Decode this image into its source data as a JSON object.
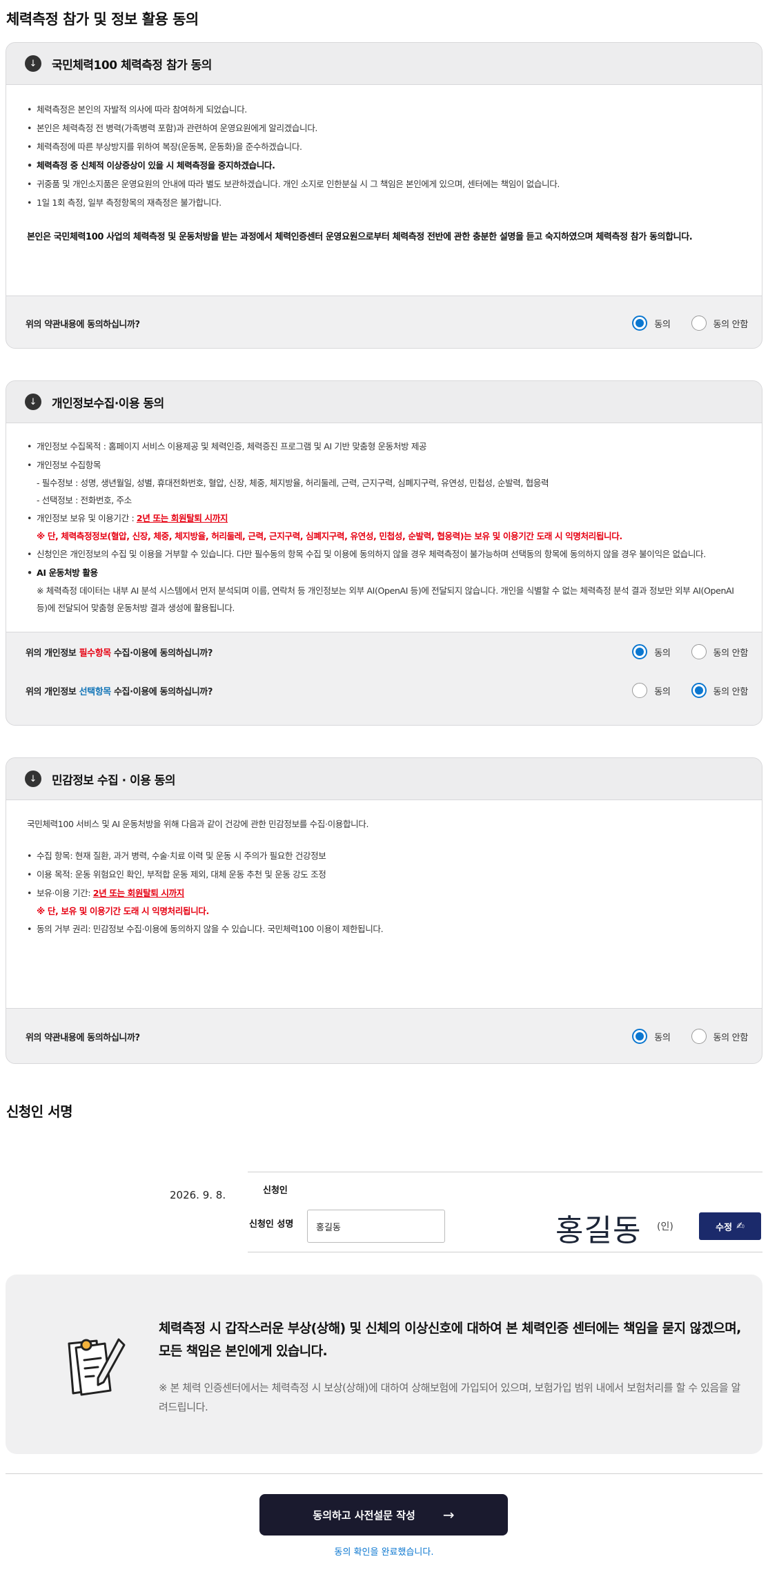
{
  "page": {
    "title": "체력측정 참가 및 정보 활용 동의"
  },
  "panel1": {
    "title": "국민체력100 체력측정 참가 동의",
    "items": [
      "체력측정은 본인의 자발적 의사에 따라 참여하게 되었습니다.",
      "본인은 체력측정 전 병력(가족병력 포함)과 관련하여 운영요원에게 알리겠습니다.",
      "체력측정에 따른 부상방지를 위하여 복장(운동복, 운동화)을 준수하겠습니다.",
      "체력측정 중 신체적 이상증상이 있을 시 체력측정을 중지하겠습니다.",
      "귀중품 및 개인소지품은 운영요원의 안내에 따라 별도 보관하겠습니다. 개인 소지로 인한분실 시 그 책임은 본인에게 있으며, 센터에는 책임이 없습니다.",
      "1일 1회 측정, 일부 측정항목의 재측정은 불가합니다."
    ],
    "statement": "본인은 국민체력100 사업의 체력측정 및 운동처방을 받는 과정에서 체력인증센터 운영요원으로부터 체력측정 전반에 관한 충분한 설명을 듣고 숙지하였으며 체력측정 참가 동의합니다.",
    "question": "위의 약관내용에 동의하십니까?",
    "agree": "동의",
    "disagree": "동의 안함"
  },
  "panel2": {
    "title": "개인정보수집·이용 동의",
    "purpose": "개인정보 수집목적 : 홈페이지 서비스 이용제공 및 체력인증, 체력증진 프로그램 및 AI 기반 맞춤형 운동처방 제공",
    "items_label": "개인정보 수집항목",
    "required_items": "- 필수정보 : 성명, 생년월일, 성별, 휴대전화번호, 혈압, 신장, 체중, 체지방율, 허리둘레, 근력, 근지구력, 심폐지구력, 유연성, 민첩성, 순발력, 협응력",
    "optional_items": "- 선택정보 : 전화번호, 주소",
    "retention_label": "개인정보 보유 및 이용기간 : ",
    "retention_value": "2년 또는 회원탈퇴 시까지",
    "retention_note": "※ 단, 체력측정정보(혈압, 신장, 체중, 체지방율, 허리둘레, 근력, 근지구력, 심폐지구력, 유연성, 민첩성, 순발력, 협응력)는 보유 및 이용기간 도래 시 익명처리됩니다.",
    "refusal": "신청인은 개인정보의 수집 및 이용을 거부할 수 있습니다. 다만 필수동의 항목 수집 및 이용에 동의하지 않을 경우 체력측정이 불가능하며 선택동의 항목에 동의하지 않을 경우 불이익은 없습니다.",
    "ai_label": "AI 운동처방 활용",
    "ai_note": "※ 체력측정 데이터는 내부 AI 분석 시스템에서 먼저 분석되며 이름, 연락처 등 개인정보는 외부 AI(OpenAI 등)에 전달되지 않습니다. 개인을 식별할 수 없는 체력측정 분석 결과 정보만 외부 AI(OpenAI 등)에 전달되어 맞춤형 운동처방 결과 생성에 활용됩니다.",
    "q_required_pre": "위의 개인정보 ",
    "q_required_key": "필수항목",
    "q_required_post": " 수집·이용에 동의하십니까?",
    "q_optional_pre": "위의 개인정보 ",
    "q_optional_key": "선택항목",
    "q_optional_post": " 수집·이용에 동의하십니까?",
    "agree": "동의",
    "disagree": "동의 안함"
  },
  "panel3": {
    "title": "민감정보 수집 · 이용 동의",
    "intro": "국민체력100 서비스 및 AI 운동처방을 위해 다음과 같이 건강에 관한 민감정보를 수집·이용합니다.",
    "items": [
      "수집 항목: 현재 질환, 과거 병력, 수술·치료 이력 및 운동 시 주의가 필요한 건강정보",
      "이용 목적: 운동 위험요인 확인, 부적합 운동 제외, 대체 운동 추천 및 운동 강도 조정"
    ],
    "retention_label": "보유·이용 기간: ",
    "retention_value": "2년 또는 회원탈퇴 시까지",
    "retention_note": "※ 단, 보유 및 이용기간 도래 시 익명처리됩니다.",
    "refusal": "동의 거부 권리: 민감정보 수집·이용에 동의하지 않을 수 있습니다. 국민체력100 이용이 제한됩니다.",
    "question": "위의 약관내용에 동의하십니까?",
    "agree": "동의",
    "disagree": "동의 안함"
  },
  "signature": {
    "section_title": "신청인 서명",
    "date": "2026. 9. 8.",
    "applicant_label": "신청인",
    "name_label": "신청인 성명",
    "name_value": "홍길동",
    "signature_text": "홍길동",
    "seal": "(인)",
    "edit_label": "수정"
  },
  "notice": {
    "title": "체력측정 시 갑작스러운 부상(상해) 및 신체의 이상신호에 대하여 본 체력인증 센터에는 책임을 묻지 않겠으며, 모든 책임은 본인에게 있습니다.",
    "sub": "※ 본 체력 인증센터에서는 체력측정 시 보상(상해)에 대하여 상해보험에 가입되어 있으며, 보험가입 범위 내에서 보험처리를 할 수 있음을 알려드립니다.",
    "icon": "clipboard-pen-icon"
  },
  "footer": {
    "submit_label": "동의하고 사전설문 작성",
    "done_message": "동의 확인을 완료했습니다."
  },
  "colors": {
    "accent": "#0b77d0",
    "primary_button": "#1a1a2e",
    "edit_button": "#1b2a6b",
    "warning": "#e60012"
  }
}
